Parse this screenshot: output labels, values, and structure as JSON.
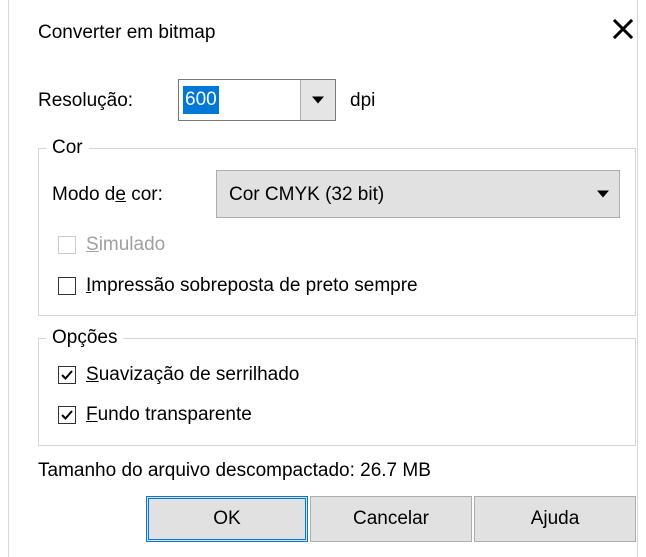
{
  "dialog": {
    "title": "Converter em bitmap",
    "close_icon": "close-icon"
  },
  "resolution": {
    "label": "Resolução:",
    "value": "600",
    "unit": "dpi"
  },
  "color_group": {
    "legend": "Cor",
    "mode_label_pre": "Modo d",
    "mode_label_ul": "e",
    "mode_label_post": " cor:",
    "mode_selected": "Cor CMYK (32 bit)",
    "simulated": {
      "ul": "S",
      "rest": "imulado",
      "checked": false,
      "enabled": false
    },
    "overprint": {
      "ul": "I",
      "rest": "mpressão sobreposta de preto sempre",
      "checked": false,
      "enabled": true
    }
  },
  "options_group": {
    "legend": "Opções",
    "antialias": {
      "ul": "S",
      "rest": "uavização de serrilhado",
      "checked": true
    },
    "transparent": {
      "ul": "F",
      "rest": "undo transparente",
      "checked": true
    }
  },
  "file_size": "Tamanho do arquivo descompactado: 26.7 MB",
  "buttons": {
    "ok": "OK",
    "cancel": "Cancelar",
    "help": "Ajuda"
  },
  "colors": {
    "selection": "#0078d7",
    "button_face": "#e1e1e1",
    "border": "#adadad"
  }
}
